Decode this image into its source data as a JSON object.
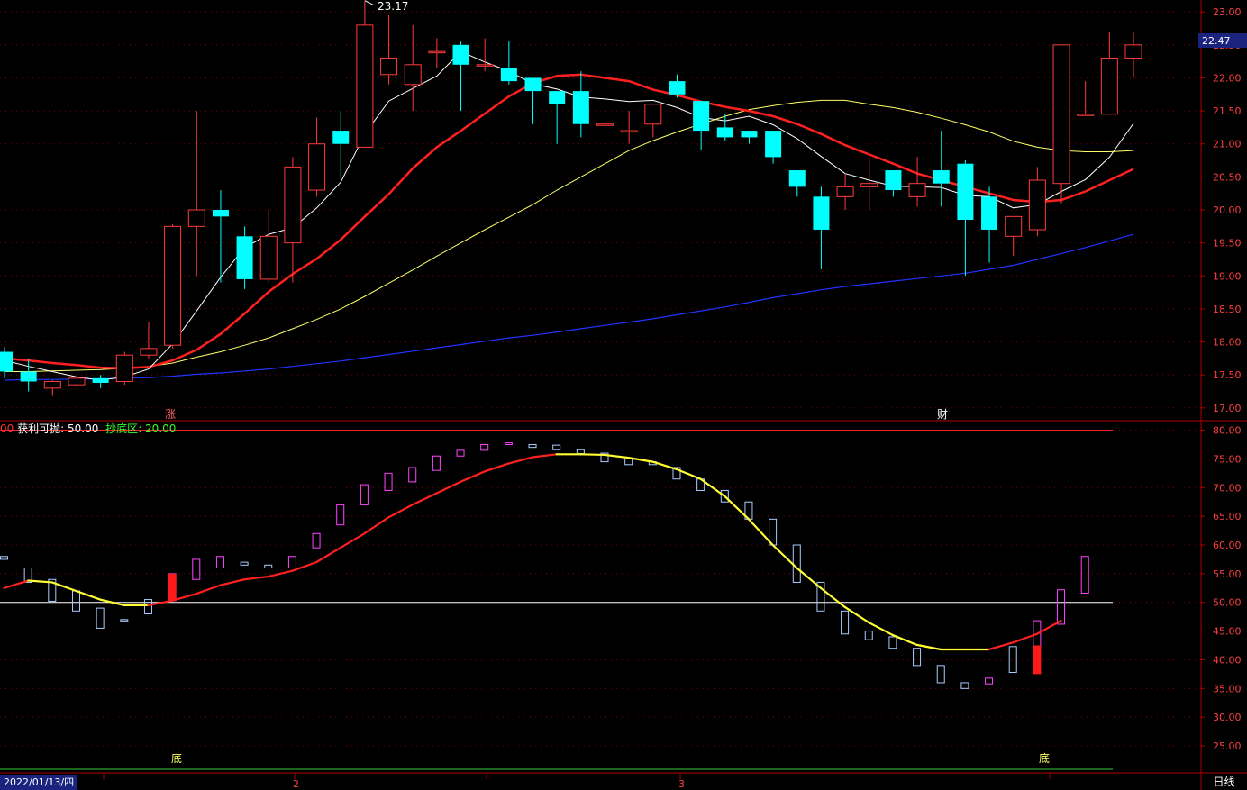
{
  "date": "2022/01/13/四",
  "period": "日线",
  "price_label": "22.47",
  "peak_label": "23.17",
  "header": {
    "cut": "00",
    "profit_label": "获利可抛",
    "profit_value": "50.00",
    "bottom_label": "抄底区",
    "bottom_value": "20.00"
  },
  "markers": {
    "zhang": "涨",
    "cai": "财",
    "di": "底"
  },
  "month_ticks": [
    "2",
    "3"
  ],
  "colors": {
    "up": "#ff3b3b",
    "down": "#00ffff",
    "ma5": "#ffffff",
    "ma10": "#ff2020",
    "ma20": "#ffff66",
    "ma60": "#2233ff",
    "axis": "#b00000",
    "grid": "#7a0000"
  },
  "chart_data": [
    {
      "type": "candlestick",
      "price_axis": {
        "ylim": [
          16.82,
          23.18
        ],
        "ticks": [
          "17.00",
          "17.50",
          "18.00",
          "18.50",
          "19.00",
          "19.50",
          "20.00",
          "20.50",
          "21.00",
          "21.50",
          "22.00",
          "22.50",
          "23.00"
        ]
      },
      "candles": [
        [
          17.85,
          17.55,
          17.92,
          17.45
        ],
        [
          17.55,
          17.4,
          17.75,
          17.25
        ],
        [
          17.3,
          17.4,
          17.42,
          17.18
        ],
        [
          17.35,
          17.45,
          17.48,
          17.32
        ],
        [
          17.45,
          17.38,
          17.5,
          17.3
        ],
        [
          17.4,
          17.8,
          17.85,
          17.35
        ],
        [
          17.8,
          17.9,
          18.3,
          17.75
        ],
        [
          17.95,
          19.75,
          19.78,
          17.9
        ],
        [
          19.75,
          20.0,
          21.5,
          19.0
        ],
        [
          20.0,
          19.9,
          20.3,
          18.9
        ],
        [
          19.6,
          18.95,
          19.75,
          18.8
        ],
        [
          18.95,
          19.6,
          20.0,
          18.9
        ],
        [
          19.5,
          20.65,
          20.8,
          18.9
        ],
        [
          20.3,
          21.0,
          21.4,
          20.2
        ],
        [
          21.2,
          21.0,
          21.5,
          20.5
        ],
        [
          20.95,
          22.8,
          23.17,
          20.95
        ],
        [
          22.05,
          22.3,
          22.95,
          21.9
        ],
        [
          21.9,
          22.2,
          22.8,
          21.5
        ],
        [
          22.4,
          22.4,
          22.6,
          22.15
        ],
        [
          22.5,
          22.2,
          22.55,
          21.5
        ],
        [
          22.2,
          22.2,
          22.6,
          22.1
        ],
        [
          22.15,
          21.95,
          22.55,
          21.9
        ],
        [
          22.0,
          21.8,
          22.0,
          21.3
        ],
        [
          21.8,
          21.6,
          21.75,
          21.0
        ],
        [
          21.8,
          21.3,
          22.1,
          21.1
        ],
        [
          21.3,
          21.3,
          22.2,
          20.8
        ],
        [
          21.2,
          21.2,
          21.5,
          21.0
        ],
        [
          21.3,
          21.6,
          21.55,
          21.1
        ],
        [
          21.95,
          21.75,
          22.05,
          21.7
        ],
        [
          21.65,
          21.2,
          21.5,
          20.9
        ],
        [
          21.25,
          21.1,
          21.45,
          21.05
        ],
        [
          21.2,
          21.1,
          21.15,
          21.0
        ],
        [
          21.2,
          20.8,
          21.2,
          20.7
        ],
        [
          20.6,
          20.35,
          20.6,
          20.2
        ],
        [
          20.2,
          19.7,
          20.35,
          19.1
        ],
        [
          20.2,
          20.35,
          20.55,
          20.0
        ],
        [
          20.35,
          20.4,
          20.8,
          20.0
        ],
        [
          20.6,
          20.3,
          20.6,
          20.2
        ],
        [
          20.2,
          20.4,
          20.8,
          20.05
        ],
        [
          20.6,
          20.4,
          21.2,
          20.05
        ],
        [
          20.7,
          19.85,
          20.75,
          19.0
        ],
        [
          20.2,
          19.7,
          20.35,
          19.2
        ],
        [
          19.6,
          19.9,
          19.85,
          19.3
        ],
        [
          19.7,
          20.45,
          20.65,
          19.6
        ],
        [
          20.4,
          22.5,
          22.5,
          20.1
        ],
        [
          21.45,
          21.45,
          21.95,
          21.45
        ],
        [
          21.45,
          22.3,
          22.7,
          21.45
        ],
        [
          22.3,
          22.5,
          22.7,
          22.0
        ]
      ],
      "ma5": [
        17.72,
        17.63,
        17.55,
        17.47,
        17.42,
        17.47,
        17.59,
        17.97,
        18.47,
        18.98,
        19.43,
        19.63,
        19.73,
        20.03,
        20.42,
        21.15,
        21.65,
        21.84,
        22.03,
        22.4,
        22.24,
        22.1,
        21.91,
        21.83,
        21.71,
        21.68,
        21.64,
        21.66,
        21.55,
        21.4,
        21.35,
        21.42,
        21.29,
        21.08,
        20.81,
        20.55,
        20.45,
        20.36,
        20.35,
        20.34,
        20.22,
        20.2,
        20.03,
        20.08,
        20.28,
        20.46,
        20.8,
        21.31
      ],
      "ma10": [
        17.75,
        17.72,
        17.68,
        17.65,
        17.61,
        17.6,
        17.62,
        17.72,
        17.88,
        18.12,
        18.43,
        18.76,
        19.03,
        19.26,
        19.55,
        19.9,
        20.24,
        20.63,
        20.95,
        21.2,
        21.46,
        21.72,
        21.92,
        22.03,
        22.05,
        22.0,
        21.95,
        21.82,
        21.74,
        21.64,
        21.56,
        21.5,
        21.42,
        21.3,
        21.15,
        20.98,
        20.84,
        20.7,
        20.55,
        20.45,
        20.35,
        20.25,
        20.15,
        20.12,
        20.15,
        20.28,
        20.45,
        20.62
      ],
      "ma20": [
        17.55,
        17.55,
        17.56,
        17.57,
        17.58,
        17.6,
        17.63,
        17.68,
        17.77,
        17.85,
        17.95,
        18.06,
        18.2,
        18.34,
        18.5,
        18.69,
        18.89,
        19.09,
        19.3,
        19.5,
        19.7,
        19.89,
        20.08,
        20.3,
        20.5,
        20.7,
        20.9,
        21.05,
        21.18,
        21.3,
        21.42,
        21.52,
        21.58,
        21.63,
        21.66,
        21.66,
        21.6,
        21.55,
        21.48,
        21.39,
        21.29,
        21.18,
        21.04,
        20.95,
        20.9,
        20.88,
        20.88,
        20.9
      ],
      "ma60": [
        17.42,
        17.43,
        17.43,
        17.44,
        17.44,
        17.45,
        17.46,
        17.48,
        17.51,
        17.53,
        17.56,
        17.59,
        17.63,
        17.67,
        17.71,
        17.76,
        17.81,
        17.86,
        17.91,
        17.96,
        18.01,
        18.06,
        18.1,
        18.15,
        18.2,
        18.25,
        18.3,
        18.35,
        18.41,
        18.47,
        18.53,
        18.6,
        18.67,
        18.73,
        18.79,
        18.84,
        18.88,
        18.92,
        18.96,
        19.0,
        19.04,
        19.1,
        19.16,
        19.25,
        19.34,
        19.43,
        19.53,
        19.63
      ]
    },
    {
      "type": "line",
      "title": "获利可抛 / 抄底区",
      "ylim": [
        20.3,
        81.5
      ],
      "ticks": [
        "25.00",
        "30.00",
        "35.00",
        "40.00",
        "45.00",
        "50.00",
        "55.00",
        "60.00",
        "65.00",
        "70.00",
        "75.00",
        "80.00"
      ],
      "reference_lines": [
        80,
        50
      ],
      "boxes": [
        [
          58,
          57.5
        ],
        [
          56,
          53.5
        ],
        [
          54,
          50.2
        ],
        [
          52,
          48.5
        ],
        [
          49,
          45.5
        ],
        [
          47,
          46.8
        ],
        [
          50.5,
          48
        ],
        [
          50.3,
          55
        ],
        [
          54,
          57.5
        ],
        [
          56,
          58
        ],
        [
          57,
          56.5
        ],
        [
          56.5,
          56
        ],
        [
          56,
          58
        ],
        [
          59.5,
          62
        ],
        [
          63.5,
          67
        ],
        [
          67,
          70.5
        ],
        [
          69.5,
          72.5
        ],
        [
          71,
          73.5
        ],
        [
          73,
          75.5
        ],
        [
          75.5,
          76.5
        ],
        [
          76.5,
          77.5
        ],
        [
          77.5,
          77.8
        ],
        [
          77.5,
          77
        ],
        [
          77.4,
          76.6
        ],
        [
          76.6,
          75.9
        ],
        [
          76,
          74.5
        ],
        [
          75,
          74
        ],
        [
          74.5,
          74
        ],
        [
          73.5,
          71.5
        ],
        [
          71.5,
          69.5
        ],
        [
          69.5,
          67.5
        ],
        [
          67.5,
          64.5
        ],
        [
          64.5,
          60
        ],
        [
          60,
          53.5
        ],
        [
          53.5,
          48.5
        ],
        [
          48.5,
          44.5
        ],
        [
          45,
          43.5
        ],
        [
          44,
          42
        ],
        [
          42,
          39
        ],
        [
          39,
          36
        ],
        [
          36,
          35
        ],
        [
          35.8,
          36.8
        ],
        [
          42.3,
          37.8
        ],
        [
          41.8,
          46.8
        ],
        [
          46.2,
          52.2
        ],
        [
          51.6,
          58
        ]
      ],
      "signal": [
        52.5,
        53.8,
        53.5,
        52,
        50.5,
        49.5,
        49.5,
        50.3,
        51.5,
        53,
        54,
        54.5,
        55.5,
        57,
        59.5,
        62,
        64.8,
        67,
        69,
        71,
        72.8,
        74.2,
        75.3,
        75.8,
        75.8,
        75.7,
        75.2,
        74.5,
        73.2,
        71.5,
        68.5,
        64.5,
        60,
        56,
        52.5,
        49.2,
        46.5,
        44.3,
        42.6,
        41.8,
        41.8,
        41.8,
        43,
        44.5,
        46.8
      ],
      "signal_colors": [
        "red",
        "yellow",
        "yellow",
        "yellow",
        "yellow",
        "yellow",
        "red",
        "red",
        "red",
        "red",
        "red",
        "red",
        "red",
        "red",
        "red",
        "red",
        "red",
        "red",
        "red",
        "red",
        "red",
        "red",
        "red",
        "yellow",
        "yellow",
        "yellow",
        "yellow",
        "yellow",
        "yellow",
        "yellow",
        "yellow",
        "yellow",
        "yellow",
        "yellow",
        "yellow",
        "yellow",
        "yellow",
        "yellow",
        "yellow",
        "yellow",
        "yellow",
        "red",
        "red",
        "red",
        "red"
      ]
    }
  ]
}
